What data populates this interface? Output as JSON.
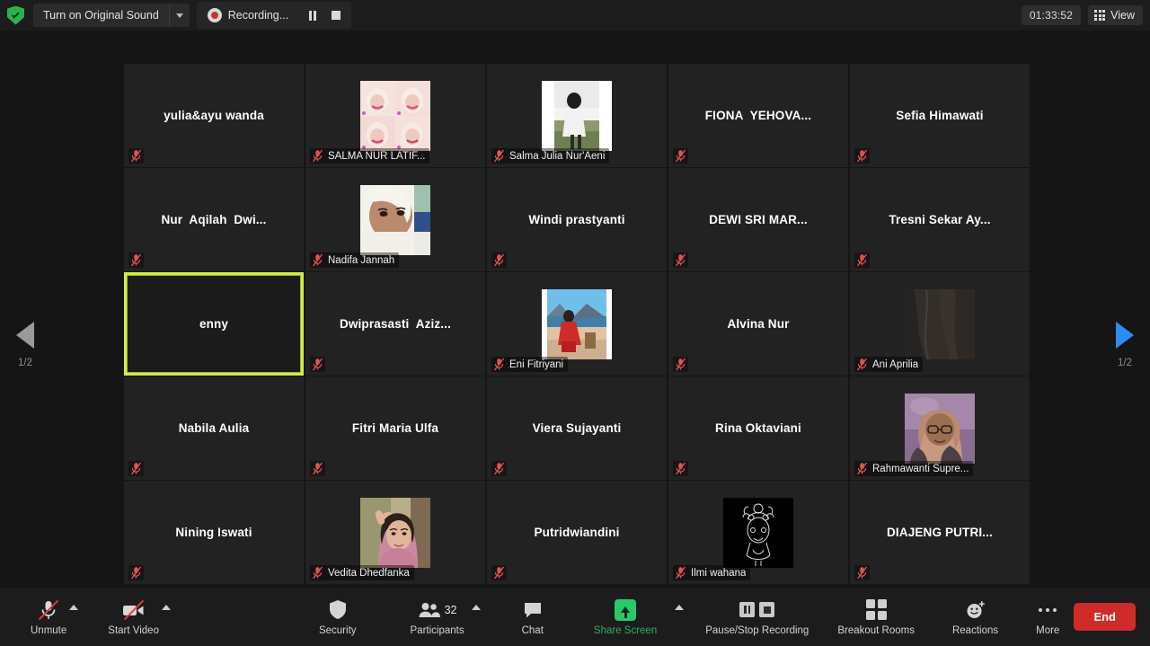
{
  "topbar": {
    "security_shield_icon": "shield-check-icon",
    "original_sound_label": "Turn on Original Sound",
    "original_sound_caret_icon": "chevron-down-icon",
    "recording_label": "Recording...",
    "recording_dot_icon": "record-dot-icon",
    "pause_icon": "pause-icon",
    "stop_icon": "stop-icon",
    "timer": "01:33:52",
    "view_label": "View",
    "view_icon": "grid-view-icon"
  },
  "pager": {
    "prev_icon": "triangle-left-icon",
    "next_icon": "triangle-right-icon",
    "prev_page_label": "1/2",
    "next_page_label": "1/2",
    "prev_color": "#9a9a9a",
    "next_color": "#2d8cf0"
  },
  "gallery": {
    "active_border_color": "#d6e84f",
    "mute_icon": "microphone-muted-icon",
    "tiles": [
      {
        "name": "yulia&ayu wanda",
        "video": false,
        "muted": true,
        "active": false,
        "avatar": null
      },
      {
        "name": "SALMA NUR LATIF...",
        "video": true,
        "muted": true,
        "active": false,
        "avatar": "collage-pink-portrait"
      },
      {
        "name": "Salma Julia Nur'Aeni",
        "video": true,
        "muted": true,
        "active": false,
        "avatar": "outdoor-field-person"
      },
      {
        "name": "FIONA  YEHOVA...",
        "video": false,
        "muted": true,
        "active": false,
        "avatar": null
      },
      {
        "name": "Sefia Himawati",
        "video": false,
        "muted": true,
        "active": false,
        "avatar": null
      },
      {
        "name": "Nur  Aqilah  Dwi...",
        "video": false,
        "muted": true,
        "active": false,
        "avatar": null
      },
      {
        "name": "Nadifa Jannah",
        "video": true,
        "muted": true,
        "active": false,
        "avatar": "white-hijab-closeup"
      },
      {
        "name": "Windi prastyanti",
        "video": false,
        "muted": true,
        "active": false,
        "avatar": null
      },
      {
        "name": "DEWI SRI MAR...",
        "video": false,
        "muted": true,
        "active": false,
        "avatar": null
      },
      {
        "name": "Tresni Sekar Ay...",
        "video": false,
        "muted": true,
        "active": false,
        "avatar": null
      },
      {
        "name": "enny",
        "video": false,
        "muted": false,
        "active": true,
        "avatar": null
      },
      {
        "name": "Dwiprasasti  Aziz...",
        "video": false,
        "muted": true,
        "active": false,
        "avatar": null
      },
      {
        "name": "Eni Fitriyani",
        "video": true,
        "muted": true,
        "active": false,
        "avatar": "beach-red-dress"
      },
      {
        "name": "Alvina Nur",
        "video": false,
        "muted": true,
        "active": false,
        "avatar": null
      },
      {
        "name": "Ani Aprilia",
        "video": true,
        "muted": true,
        "active": false,
        "avatar": "dark-fabric"
      },
      {
        "name": "Nabila Aulia",
        "video": false,
        "muted": true,
        "active": false,
        "avatar": null
      },
      {
        "name": "Fitri Maria Ulfa",
        "video": false,
        "muted": true,
        "active": false,
        "avatar": null
      },
      {
        "name": "Viera Sujayanti",
        "video": false,
        "muted": true,
        "active": false,
        "avatar": null
      },
      {
        "name": "Rina Oktaviani",
        "video": false,
        "muted": true,
        "active": false,
        "avatar": null
      },
      {
        "name": "Rahmawanti Supre...",
        "video": true,
        "muted": true,
        "active": false,
        "avatar": "purple-hijab-glasses"
      },
      {
        "name": "Nining Iswati",
        "video": false,
        "muted": true,
        "active": false,
        "avatar": null
      },
      {
        "name": "Vedita Dhedfanka",
        "video": true,
        "muted": true,
        "active": false,
        "avatar": "pink-hijab-portrait"
      },
      {
        "name": "Putridwiandini",
        "video": false,
        "muted": true,
        "active": false,
        "avatar": null
      },
      {
        "name": "Ilmi wahana",
        "video": true,
        "muted": true,
        "active": false,
        "avatar": "line-art-sketch"
      },
      {
        "name": "DIAJENG PUTRI...",
        "video": false,
        "muted": true,
        "active": false,
        "avatar": null
      }
    ]
  },
  "toolbar": {
    "unmute_label": "Unmute",
    "unmute_icon": "microphone-muted-icon",
    "unmute_caret_icon": "chevron-up-icon",
    "start_video_label": "Start Video",
    "start_video_icon": "camera-off-icon",
    "start_video_caret_icon": "chevron-up-icon",
    "security_label": "Security",
    "security_icon": "shield-icon",
    "participants_label": "Participants",
    "participants_icon": "people-icon",
    "participants_count": "32",
    "participants_caret_icon": "chevron-up-icon",
    "chat_label": "Chat",
    "chat_icon": "chat-bubble-icon",
    "share_screen_label": "Share Screen",
    "share_screen_icon": "share-arrow-up-icon",
    "share_screen_color": "#27b263",
    "share_screen_caret_icon": "chevron-up-icon",
    "recording_label": "Pause/Stop Recording",
    "recording_pause_icon": "pause-icon",
    "recording_stop_icon": "stop-icon",
    "breakout_label": "Breakout Rooms",
    "breakout_icon": "grid-squares-icon",
    "reactions_label": "Reactions",
    "reactions_icon": "smiley-plus-icon",
    "more_label": "More",
    "more_icon": "ellipsis-icon",
    "end_label": "End",
    "end_color": "#d02b2b"
  }
}
